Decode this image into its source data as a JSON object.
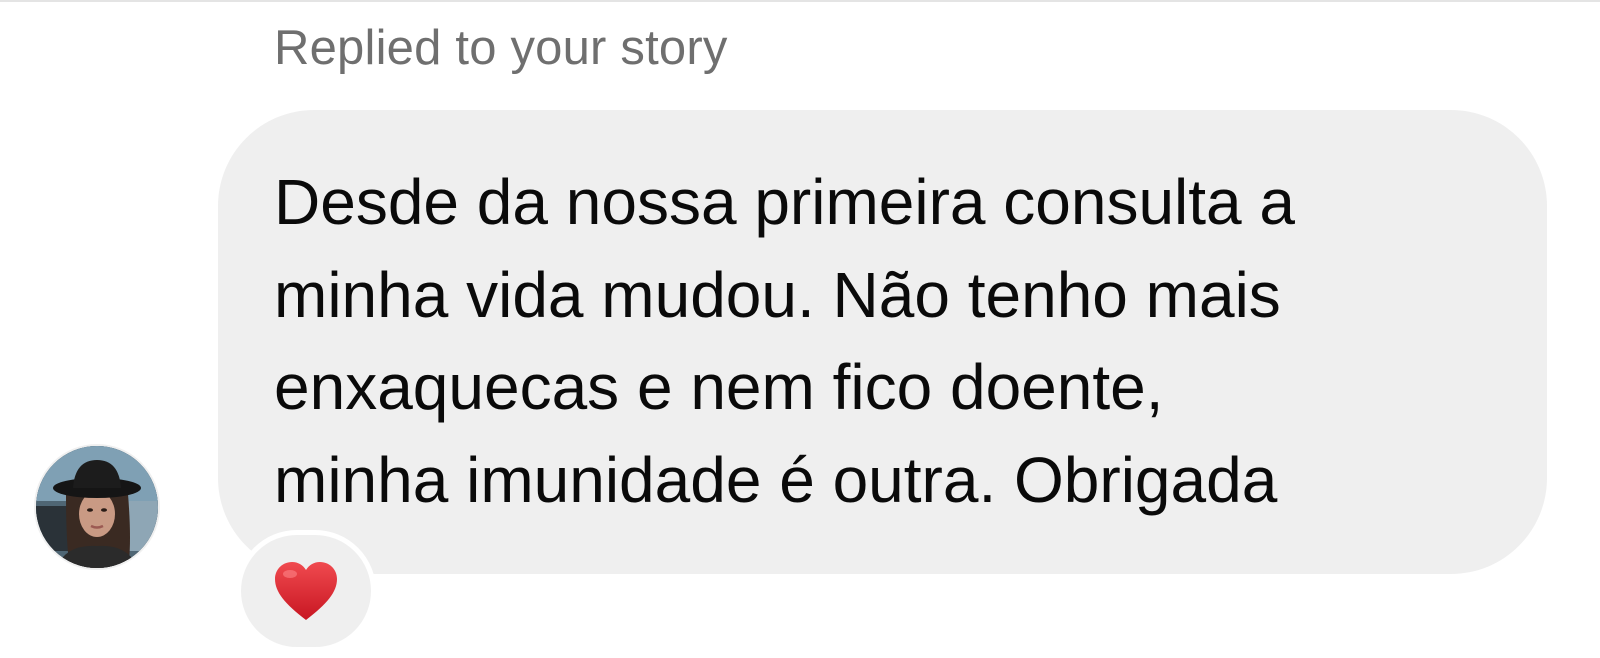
{
  "conversation": {
    "reply_context": "Replied to your story",
    "message_lines": [
      "Desde da nossa primeira consulta a",
      "minha vida mudou. Não tenho mais",
      "enxaquecas e nem fico doente,",
      "minha imunidade é outra. Obrigada"
    ],
    "reaction_icon": "red-heart-icon",
    "avatar_icon": "profile-avatar"
  },
  "colors": {
    "bubble": "#efefef",
    "text": "#0a0a0a",
    "reply_label": "#6f6f6f",
    "heart": "#e0262f"
  }
}
